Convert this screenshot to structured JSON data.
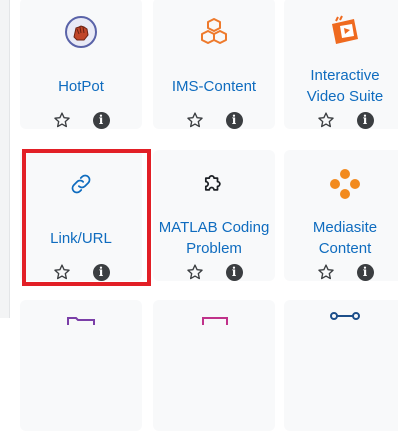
{
  "tiles": [
    {
      "name": "HotPot",
      "lines": [
        "HotPot"
      ],
      "icon": "hotpot-icon"
    },
    {
      "name": "IMS-Content",
      "lines": [
        "IMS-Content"
      ],
      "icon": "ims-content-icon"
    },
    {
      "name": "Interactive Video Suite",
      "lines": [
        "Interactive",
        "Video Suite"
      ],
      "icon": "interactive-video-icon"
    },
    {
      "name": "Link/URL",
      "lines": [
        "Link/URL"
      ],
      "icon": "link-icon"
    },
    {
      "name": "MATLAB Coding Problem",
      "lines": [
        "MATLAB Coding",
        "Problem"
      ],
      "icon": "puzzle-icon"
    },
    {
      "name": "Mediasite Content",
      "lines": [
        "Mediasite",
        "Content"
      ],
      "icon": "mediasite-icon"
    }
  ],
  "info_glyph": "i",
  "icons": {
    "star": "star-outline-icon",
    "info": "info-circle-icon"
  },
  "colors": {
    "label": "#0f6cbf",
    "highlight": "#e21f26",
    "tile_bg": "#f8f9fa"
  }
}
